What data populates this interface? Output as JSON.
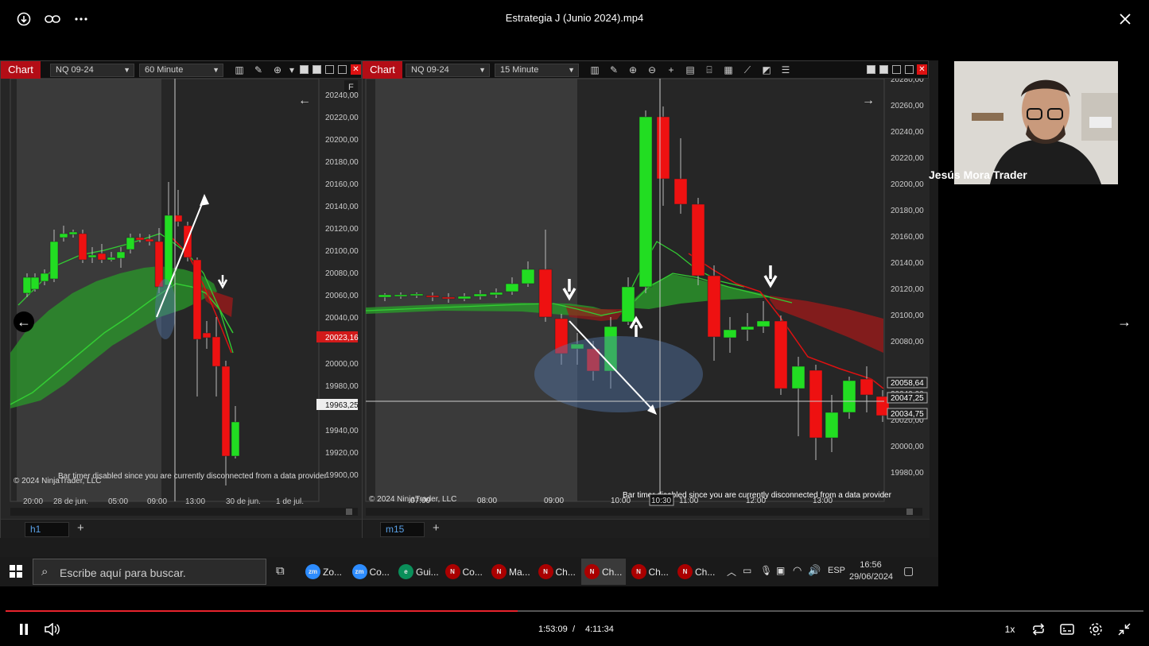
{
  "player": {
    "title": "Estrategia J (Junio 2024).mp4",
    "current_time": "1:53:09",
    "separator": "/",
    "duration": "4:11:34",
    "progress": 0.45,
    "speed": "1x",
    "presenter_name": "Jesús Mora Trader",
    "icons": [
      "download-icon",
      "link-icon",
      "more-icon",
      "close-icon",
      "prev-arrow-icon",
      "next-arrow-icon",
      "pause-icon",
      "volume-icon",
      "loop-icon",
      "captions-icon",
      "settings-icon",
      "exit-fullscreen-icon"
    ]
  },
  "charts": {
    "left": {
      "tab": "Chart",
      "instrument": "NQ 09-24",
      "interval": "60 Minute",
      "corner_label": "F",
      "price_ticks": [
        "20240,00",
        "20220,00",
        "20200,00",
        "20180,00",
        "20160,00",
        "20140,00",
        "20120,00",
        "20100,00",
        "20080,00",
        "20060,00",
        "20040,00",
        "20000,00",
        "19980,00",
        "19940,00",
        "19920,00",
        "19900,00"
      ],
      "price_flags": [
        "20023,16",
        "19963,25"
      ],
      "time_ticks": [
        "20:00",
        "28 de jun.",
        "05:00",
        "09:00",
        "13:00",
        "30 de jun.",
        "1 de jul."
      ],
      "copyright": "© 2024 NinjaTrader, LLC",
      "bar_timer": "Bar timer disabled since you are currently disconnected from a data provider",
      "sheet_tab": "h1",
      "add_tab": "+"
    },
    "right": {
      "tab": "Chart",
      "instrument": "NQ 09-24",
      "interval": "15 Minute",
      "price_ticks": [
        "20280,00",
        "20260,00",
        "20240,00",
        "20220,00",
        "20200,00",
        "20180,00",
        "20160,00",
        "20140,00",
        "20120,00",
        "20100,00",
        "20080,00",
        "20040,00",
        "20020,00",
        "20000,00",
        "19980,00"
      ],
      "price_flags": [
        "20058,64",
        "20047,25",
        "20034,75"
      ],
      "time_ticks": [
        "07:00",
        "08:00",
        "09:00",
        "10:00",
        "10:30",
        "11:00",
        "12:00",
        "13:00"
      ],
      "copyright": "© 2024 NinjaTrader, LLC",
      "bar_timer": "Bar timer disabled since you are currently disconnected from a data provider",
      "sheet_tab": "m15",
      "add_tab": "+"
    }
  },
  "taskbar": {
    "search_placeholder": "Escribe aquí para buscar.",
    "apps": [
      "Zo...",
      "Co...",
      "Gui...",
      "Co...",
      "Ma...",
      "Ch...",
      "Ch...",
      "Ch...",
      "Ch..."
    ],
    "lang": "ESP",
    "time": "16:56",
    "date": "29/06/2024"
  },
  "colors": {
    "bull": "#22dd22",
    "bear": "#ee1111",
    "cloud_green": "#2a9a2a",
    "cloud_red": "#9a1a1a",
    "accent": "#e8232d"
  }
}
